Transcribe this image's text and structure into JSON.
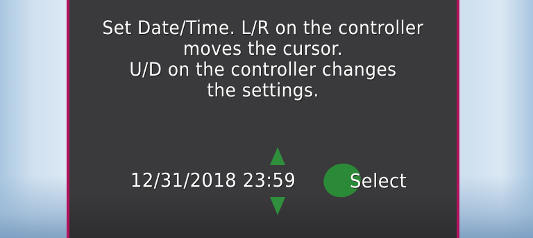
{
  "dialog": {
    "message_lines": [
      "Set Date/Time. L/R on the controller",
      "moves the cursor.",
      "U/D on the controller changes",
      "the settings."
    ],
    "datetime_value": "12/31/2018 23:59",
    "select_label": "Select"
  },
  "icons": {
    "up": "triangle-up-icon",
    "down": "triangle-down-icon",
    "select": "green-button-icon"
  },
  "colors": {
    "dialog_bg": "#3a3a3c",
    "dialog_border": "#b3125e",
    "accent_green": "#2f8f3c",
    "text": "#ffffff"
  }
}
